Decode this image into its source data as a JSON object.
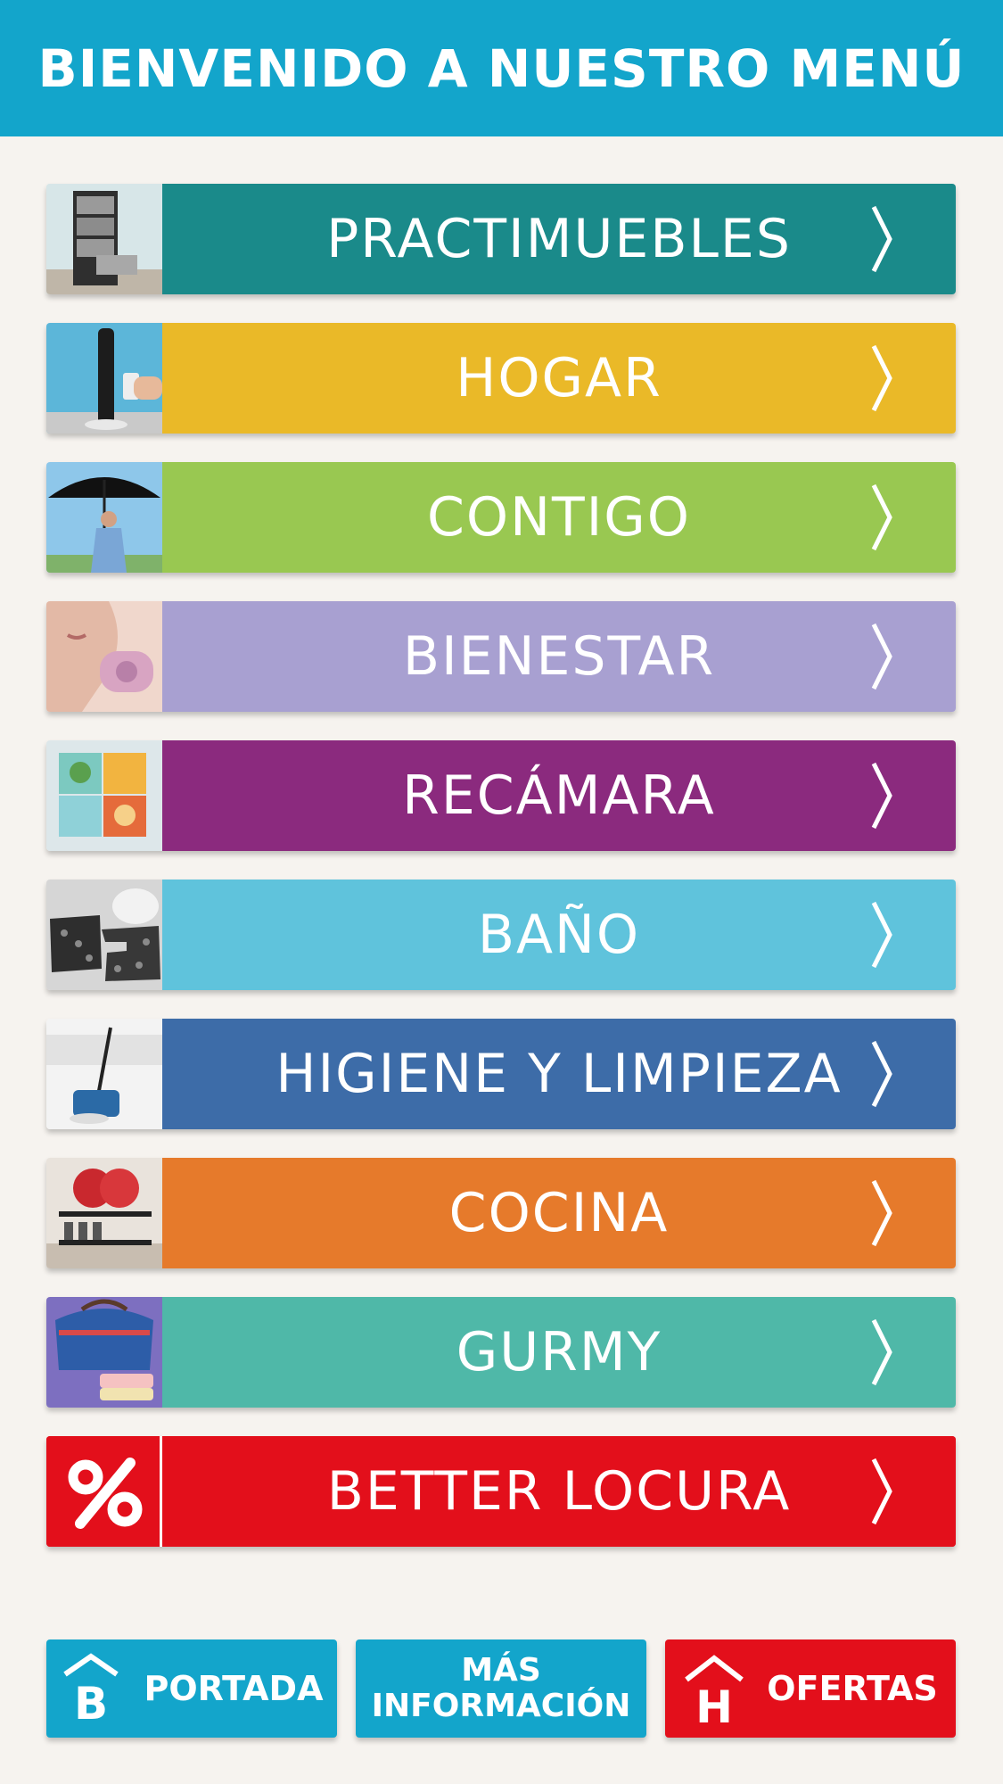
{
  "header": {
    "title": "BIENVENIDO A NUESTRO MENÚ"
  },
  "menu": {
    "items": [
      {
        "label": "PRACTIMUEBLES",
        "color": "#1a8a8a",
        "thumb": "drawer-cabinet"
      },
      {
        "label": "HOGAR",
        "color": "#eab928",
        "thumb": "tower-fan"
      },
      {
        "label": "CONTIGO",
        "color": "#99c851",
        "thumb": "umbrella"
      },
      {
        "label": "BIENESTAR",
        "color": "#a8a0d1",
        "thumb": "face-massager"
      },
      {
        "label": "RECÁMARA",
        "color": "#8b2a7e",
        "thumb": "kids-organizer"
      },
      {
        "label": "BAÑO",
        "color": "#5fc3dc",
        "thumb": "bath-mats"
      },
      {
        "label": "HIGIENE Y LIMPIEZA",
        "color": "#3d6ca8",
        "thumb": "spin-mop"
      },
      {
        "label": "COCINA",
        "color": "#e67a2b",
        "thumb": "dish-rack"
      },
      {
        "label": "GURMY",
        "color": "#4fb8a8",
        "thumb": "lunch-bag"
      },
      {
        "label": "BETTER LOCURA",
        "color": "#e30f1b",
        "thumb": "percent-icon"
      }
    ]
  },
  "footer": {
    "portada": {
      "label": "PORTADA",
      "icon": "b-house-icon",
      "color": "#13a5cb"
    },
    "info": {
      "line1": "MÁS",
      "line2": "INFORMACIÓN",
      "color": "#13a5cb"
    },
    "ofertas": {
      "label": "OFERTAS",
      "icon": "h-house-icon",
      "color": "#e30f1b"
    }
  }
}
